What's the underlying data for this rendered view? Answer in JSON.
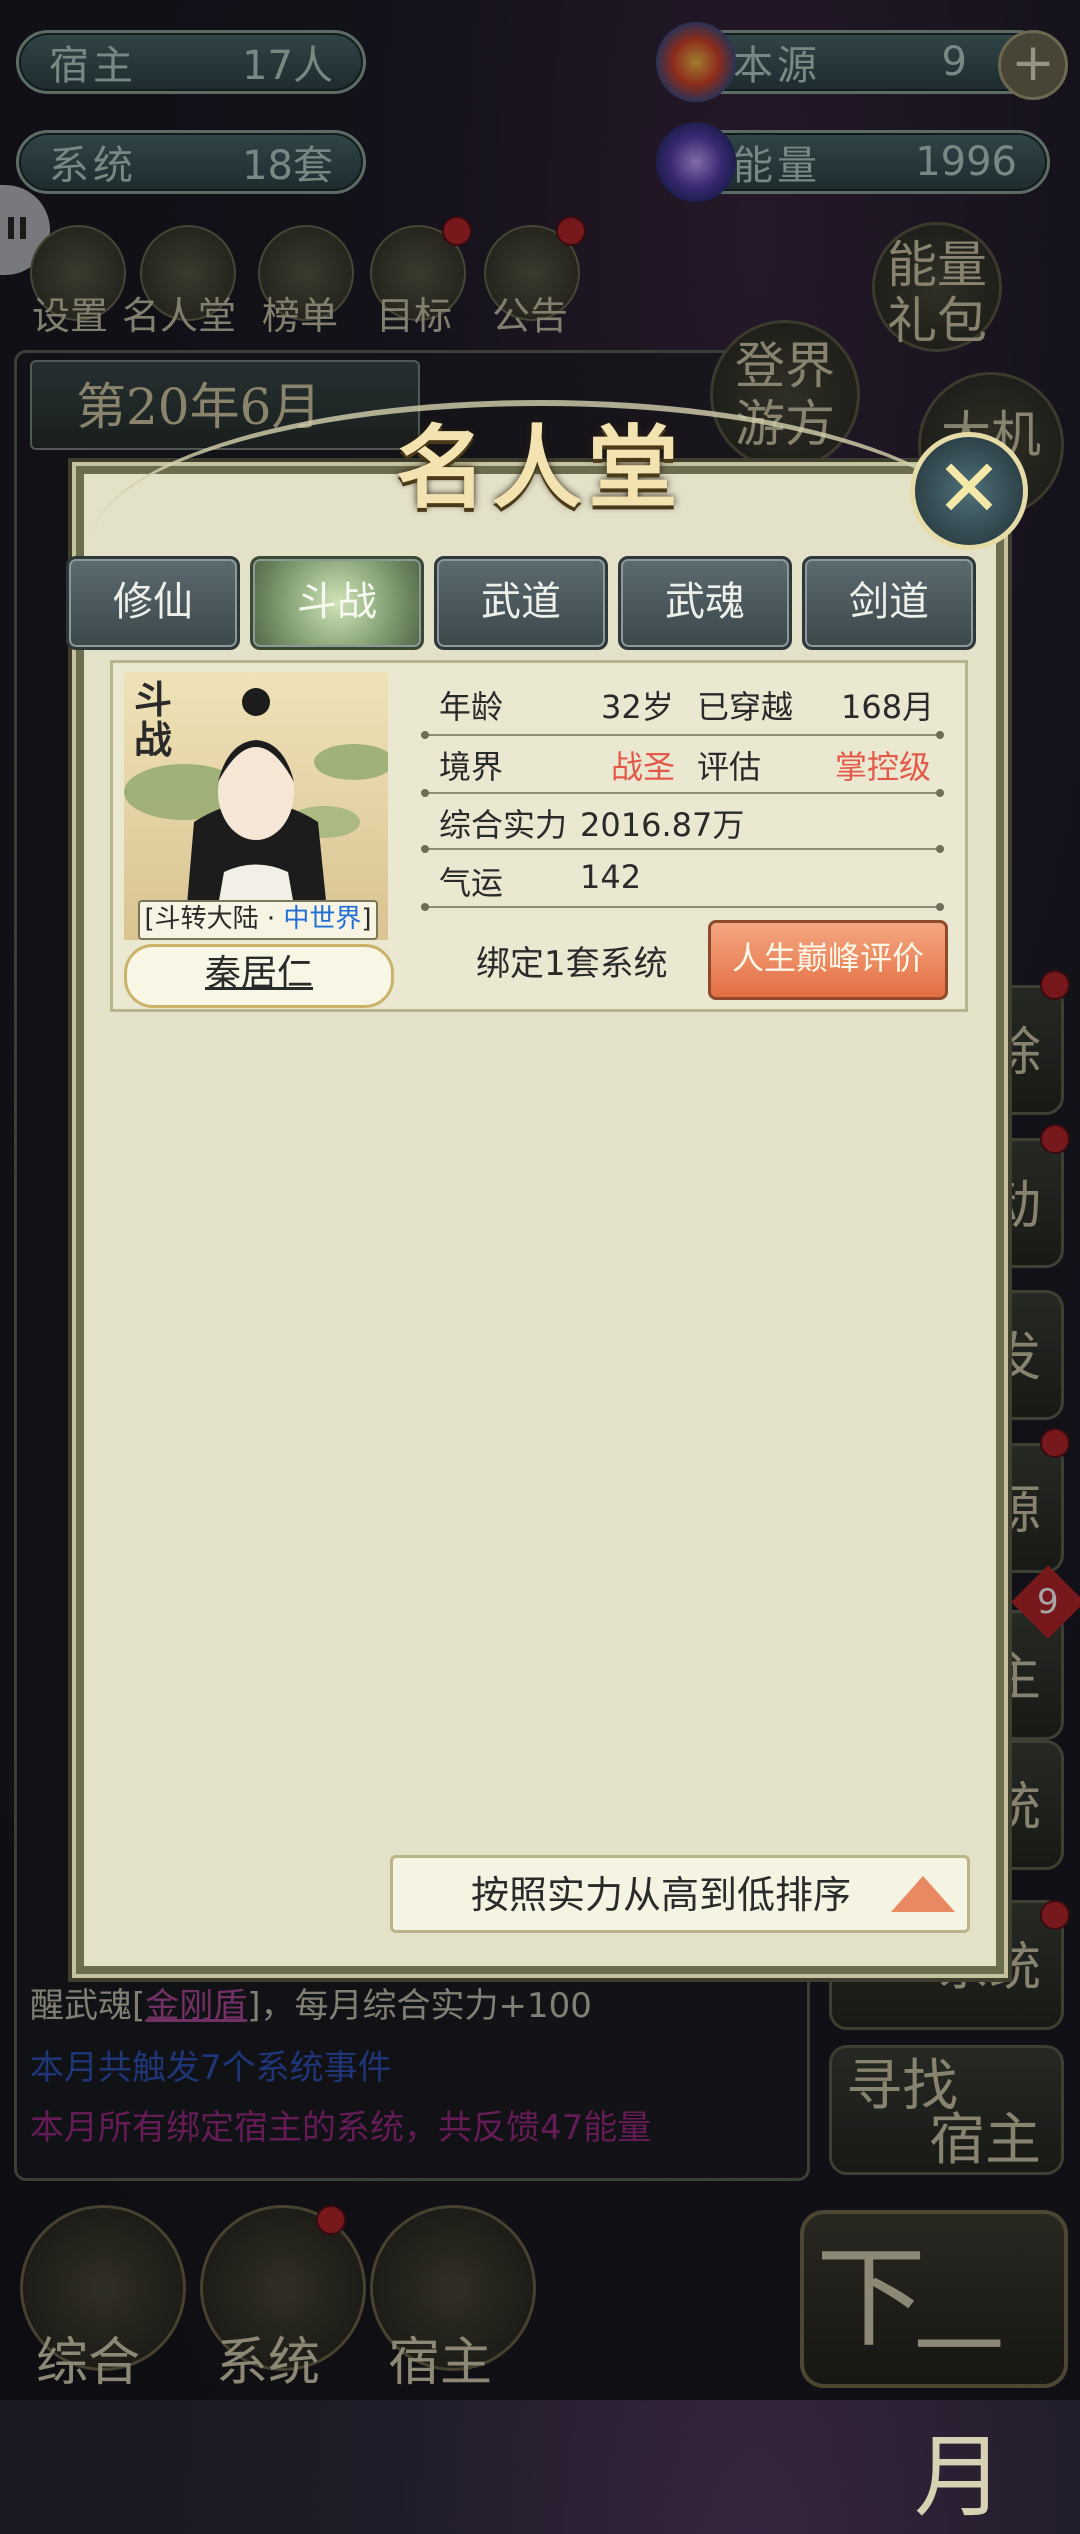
{
  "hud": {
    "host_label": "宿主",
    "host_value": "17人",
    "system_label": "系统",
    "system_value": "18套",
    "origin_label": "本源",
    "origin_value": "9",
    "energy_label": "能量",
    "energy_value": "1996",
    "plus": "+"
  },
  "top_icons": [
    "设置",
    "名人堂",
    "榜单",
    "目标",
    "公告"
  ],
  "gift_label": [
    "能量",
    "礼包"
  ],
  "travel_label": [
    "登界",
    "游方"
  ],
  "fortune_label": "大机",
  "date": "第20年6月",
  "side_buttons": [
    "除",
    "动",
    "发",
    "源",
    "主",
    "统",
    "系统"
  ],
  "side_badge": "9",
  "find_host": [
    "寻找",
    "宿主"
  ],
  "log_tail": {
    "line1_prefix": "醒武魂[",
    "line1_link": "金刚盾",
    "line1_suffix": "]，每月综合实力+100",
    "line2": "本月共触发7个系统事件",
    "line3": "本月所有绑定宿主的系统，共反馈47能量"
  },
  "bottom_nav": [
    "综合",
    "系统",
    "宿主"
  ],
  "next_month": {
    "t1": "下",
    "t2": "一月"
  },
  "modal": {
    "title": "名人堂",
    "close_icon": "✕",
    "tabs": [
      "修仙",
      "斗战",
      "武道",
      "武魂",
      "剑道"
    ],
    "active_tab": 1,
    "card": {
      "badge": "斗战",
      "world_prefix": "[斗转大陆 · ",
      "world_tier": "中世界",
      "world_suffix": "]",
      "name": "秦居仁",
      "age_label": "年龄",
      "age_value": "32岁",
      "travel_label": "已穿越",
      "travel_value": "168月",
      "realm_label": "境界",
      "realm_value": "战圣",
      "assess_label": "评估",
      "assess_value": "掌控级",
      "power_label": "综合实力",
      "power_value": "2016.87万",
      "luck_label": "气运",
      "luck_value": "142",
      "bound": "绑定1套系统",
      "eval_button": "人生巅峰评价"
    },
    "sort_label": "按照实力从高到低排序"
  },
  "colors": {
    "accent_red": "#e35a4a",
    "button_orange": "#e46f43",
    "active_tab": "#7d9a6e"
  }
}
